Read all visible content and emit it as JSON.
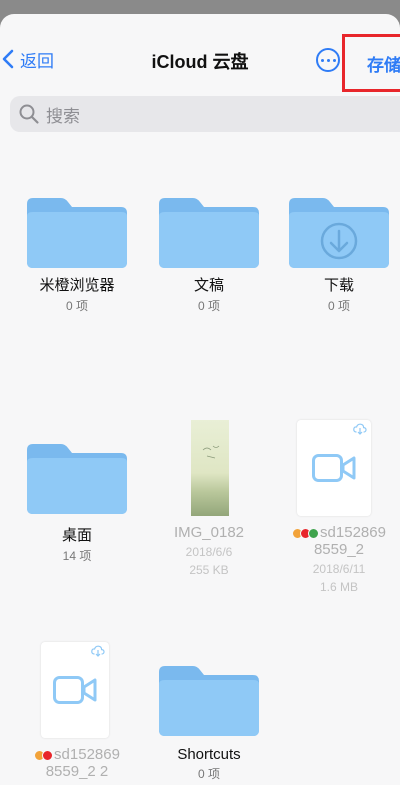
{
  "nav": {
    "back_label": "返回",
    "title": "iCloud 云盘",
    "save_label": "存储"
  },
  "search": {
    "placeholder": "搜索"
  },
  "items": [
    {
      "name": "米橙浏览器",
      "meta": "0 项"
    },
    {
      "name": "文稿",
      "meta": "0 项"
    },
    {
      "name": "下载",
      "meta": "0 项"
    },
    {
      "name": "桌面",
      "meta": "14 项"
    },
    {
      "name": "IMG_0182",
      "date": "2018/6/6",
      "size": "255 KB"
    },
    {
      "name_line1": "sd152869",
      "name_line2": "8559_2",
      "date": "2018/6/11",
      "size": "1.6 MB"
    },
    {
      "name_line1": "sd152869",
      "name_line2": "8559_2 2"
    },
    {
      "name": "Shortcuts",
      "meta": "0 项"
    }
  ],
  "colors": {
    "accent": "#2f7cf6",
    "folder": "#8fc9f6",
    "folder_tab": "#7ab9ee",
    "highlight": "#e8262b"
  }
}
